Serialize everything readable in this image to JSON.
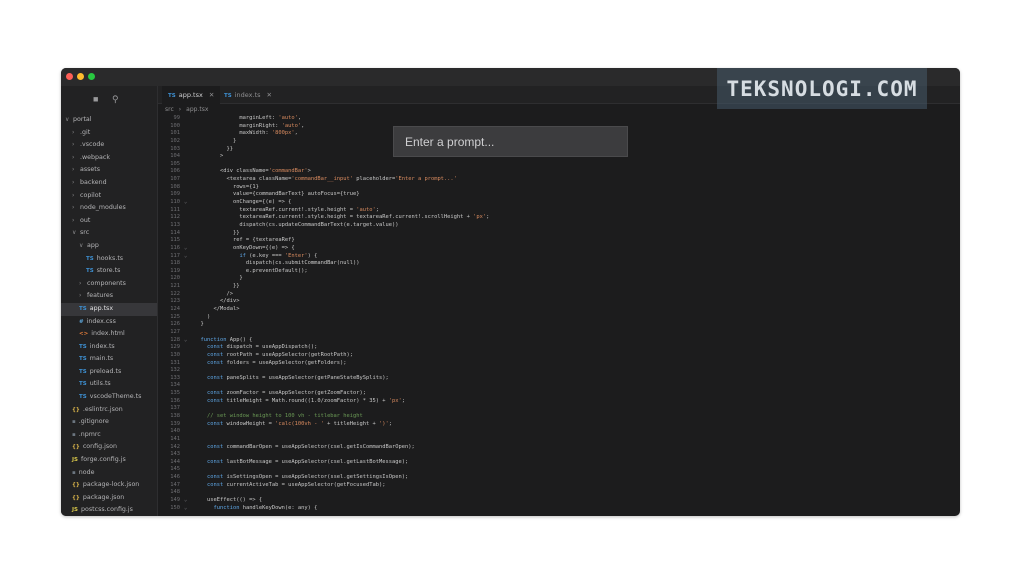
{
  "watermark": "TEKSNOLOGI.COM",
  "tabs": [
    {
      "type": "TS",
      "label": "app.tsx",
      "active": true
    },
    {
      "type": "TS",
      "label": "index.ts",
      "active": false
    }
  ],
  "breadcrumb": [
    "src",
    "app.tsx"
  ],
  "command_bar": {
    "placeholder": "Enter a prompt..."
  },
  "sidebar": {
    "items": [
      {
        "label": "portal",
        "icon": "",
        "kind": "folder-open",
        "indent": 0
      },
      {
        "label": ".git",
        "icon": "",
        "kind": "folder",
        "indent": 1
      },
      {
        "label": ".vscode",
        "icon": "",
        "kind": "folder",
        "indent": 1
      },
      {
        "label": ".webpack",
        "icon": "",
        "kind": "folder",
        "indent": 1
      },
      {
        "label": "assets",
        "icon": "",
        "kind": "folder",
        "indent": 1
      },
      {
        "label": "backend",
        "icon": "",
        "kind": "folder",
        "indent": 1
      },
      {
        "label": "copilot",
        "icon": "",
        "kind": "folder",
        "indent": 1
      },
      {
        "label": "node_modules",
        "icon": "",
        "kind": "folder",
        "indent": 1
      },
      {
        "label": "out",
        "icon": "",
        "kind": "folder",
        "indent": 1
      },
      {
        "label": "src",
        "icon": "",
        "kind": "folder-open",
        "indent": 1
      },
      {
        "label": "app",
        "icon": "",
        "kind": "folder-open",
        "indent": 2
      },
      {
        "label": "hooks.ts",
        "icon": "TS",
        "kind": "ts",
        "indent": 3
      },
      {
        "label": "store.ts",
        "icon": "TS",
        "kind": "ts",
        "indent": 3
      },
      {
        "label": "components",
        "icon": "",
        "kind": "folder",
        "indent": 2
      },
      {
        "label": "features",
        "icon": "",
        "kind": "folder",
        "indent": 2
      },
      {
        "label": "app.tsx",
        "icon": "TS",
        "kind": "ts",
        "indent": 2,
        "selected": true
      },
      {
        "label": "index.css",
        "icon": "#",
        "kind": "css",
        "indent": 2
      },
      {
        "label": "index.html",
        "icon": "<>",
        "kind": "html",
        "indent": 2
      },
      {
        "label": "index.ts",
        "icon": "TS",
        "kind": "ts",
        "indent": 2
      },
      {
        "label": "main.ts",
        "icon": "TS",
        "kind": "ts",
        "indent": 2
      },
      {
        "label": "preload.ts",
        "icon": "TS",
        "kind": "ts",
        "indent": 2
      },
      {
        "label": "utils.ts",
        "icon": "TS",
        "kind": "ts",
        "indent": 2
      },
      {
        "label": "vscodeTheme.ts",
        "icon": "TS",
        "kind": "ts",
        "indent": 2
      },
      {
        "label": ".eslintrc.json",
        "icon": "{}",
        "kind": "json",
        "indent": 1
      },
      {
        "label": ".gitignore",
        "icon": "▪",
        "kind": "plain",
        "indent": 1
      },
      {
        "label": ".npmrc",
        "icon": "▪",
        "kind": "plain",
        "indent": 1
      },
      {
        "label": "config.json",
        "icon": "{}",
        "kind": "json",
        "indent": 1
      },
      {
        "label": "forge.config.js",
        "icon": "JS",
        "kind": "js",
        "indent": 1
      },
      {
        "label": "node",
        "icon": "▪",
        "kind": "plain",
        "indent": 1
      },
      {
        "label": "package-lock.json",
        "icon": "{}",
        "kind": "json",
        "indent": 1
      },
      {
        "label": "package.json",
        "icon": "{}",
        "kind": "json",
        "indent": 1
      },
      {
        "label": "postcss.config.js",
        "icon": "JS",
        "kind": "js",
        "indent": 1
      }
    ]
  },
  "code_lines": [
    {
      "n": "99",
      "fold": "",
      "text": "              marginLeft: 'auto',"
    },
    {
      "n": "100",
      "fold": "",
      "text": "              marginRight: 'auto',"
    },
    {
      "n": "101",
      "fold": "",
      "text": "              maxWidth: '800px',"
    },
    {
      "n": "102",
      "fold": "",
      "text": "            }"
    },
    {
      "n": "103",
      "fold": "",
      "text": "          }}"
    },
    {
      "n": "104",
      "fold": "",
      "text": "        >"
    },
    {
      "n": "105",
      "fold": "",
      "text": ""
    },
    {
      "n": "106",
      "fold": "",
      "text": "        <div className='commandBar'>"
    },
    {
      "n": "107",
      "fold": "",
      "text": "          <textarea className='commandBar__input' placeholder='Enter a prompt...'"
    },
    {
      "n": "108",
      "fold": "",
      "text": "            rows={1}"
    },
    {
      "n": "109",
      "fold": "",
      "text": "            value={commandBarText} autoFocus={true}"
    },
    {
      "n": "110",
      "fold": "⌄",
      "text": "            onChange={(e) => {"
    },
    {
      "n": "111",
      "fold": "",
      "text": "              textareaRef.current!.style.height = 'auto';"
    },
    {
      "n": "112",
      "fold": "",
      "text": "              textareaRef.current!.style.height = textareaRef.current!.scrollHeight + 'px';"
    },
    {
      "n": "113",
      "fold": "",
      "text": "              dispatch(cs.updateCommandBarText(e.target.value))"
    },
    {
      "n": "114",
      "fold": "",
      "text": "            }}"
    },
    {
      "n": "115",
      "fold": "",
      "text": "            ref = {textareaRef}"
    },
    {
      "n": "116",
      "fold": "⌄",
      "text": "            onKeyDown={(e) => {"
    },
    {
      "n": "117",
      "fold": "⌄",
      "text": "              if (e.key === 'Enter') {"
    },
    {
      "n": "118",
      "fold": "",
      "text": "                dispatch(cs.submitCommandBar(null))"
    },
    {
      "n": "119",
      "fold": "",
      "text": "                e.preventDefault();"
    },
    {
      "n": "120",
      "fold": "",
      "text": "              }"
    },
    {
      "n": "121",
      "fold": "",
      "text": "            }}"
    },
    {
      "n": "122",
      "fold": "",
      "text": "          />"
    },
    {
      "n": "123",
      "fold": "",
      "text": "        </div>"
    },
    {
      "n": "124",
      "fold": "",
      "text": "      </Modal>"
    },
    {
      "n": "125",
      "fold": "",
      "text": "    )"
    },
    {
      "n": "126",
      "fold": "",
      "text": "  }"
    },
    {
      "n": "127",
      "fold": "",
      "text": ""
    },
    {
      "n": "128",
      "fold": "⌄",
      "text": "  function App() {"
    },
    {
      "n": "129",
      "fold": "",
      "text": "    const dispatch = useAppDispatch();"
    },
    {
      "n": "130",
      "fold": "",
      "text": "    const rootPath = useAppSelector(getRootPath);"
    },
    {
      "n": "131",
      "fold": "",
      "text": "    const folders = useAppSelector(getFolders);"
    },
    {
      "n": "132",
      "fold": "",
      "text": ""
    },
    {
      "n": "133",
      "fold": "",
      "text": "    const paneSplits = useAppSelector(getPaneStateBySplits);"
    },
    {
      "n": "134",
      "fold": "",
      "text": ""
    },
    {
      "n": "135",
      "fold": "",
      "text": "    const zoomFactor = useAppSelector(getZoomFactor);"
    },
    {
      "n": "136",
      "fold": "",
      "text": "    const titleHeight = Math.round((1.0/zoomFactor) * 35) + 'px';"
    },
    {
      "n": "137",
      "fold": "",
      "text": ""
    },
    {
      "n": "138",
      "fold": "",
      "text": "    // set window height to 100 vh - titlebar height"
    },
    {
      "n": "139",
      "fold": "",
      "text": "    const windowHeight = 'calc(100vh - ' + titleHeight + ')';"
    },
    {
      "n": "140",
      "fold": "",
      "text": ""
    },
    {
      "n": "141",
      "fold": "",
      "text": ""
    },
    {
      "n": "142",
      "fold": "",
      "text": "    const commandBarOpen = useAppSelector(csel.getIsCommandBarOpen);"
    },
    {
      "n": "143",
      "fold": "",
      "text": ""
    },
    {
      "n": "144",
      "fold": "",
      "text": "    const lastBotMessage = useAppSelector(csel.getLastBotMessage);"
    },
    {
      "n": "145",
      "fold": "",
      "text": ""
    },
    {
      "n": "146",
      "fold": "",
      "text": "    const isSettingsOpen = useAppSelector(ssel.getSettingsIsOpen);"
    },
    {
      "n": "147",
      "fold": "",
      "text": "    const currentActiveTab = useAppSelector(getFocusedTab);"
    },
    {
      "n": "148",
      "fold": "",
      "text": ""
    },
    {
      "n": "149",
      "fold": "⌄",
      "text": "    useEffect(() => {"
    },
    {
      "n": "150",
      "fold": "⌄",
      "text": "      function handleKeyDown(e: any) {"
    }
  ],
  "colors": {
    "background": "#ffffff",
    "window": "#1c1c1d",
    "sidebar": "#222223",
    "titlebar": "#2a2a2b",
    "ts_icon": "#3d8fd1",
    "keyword": "#5fa8e8",
    "string": "#d98b5f",
    "comment": "#6a9955",
    "function": "#dcdca0"
  }
}
